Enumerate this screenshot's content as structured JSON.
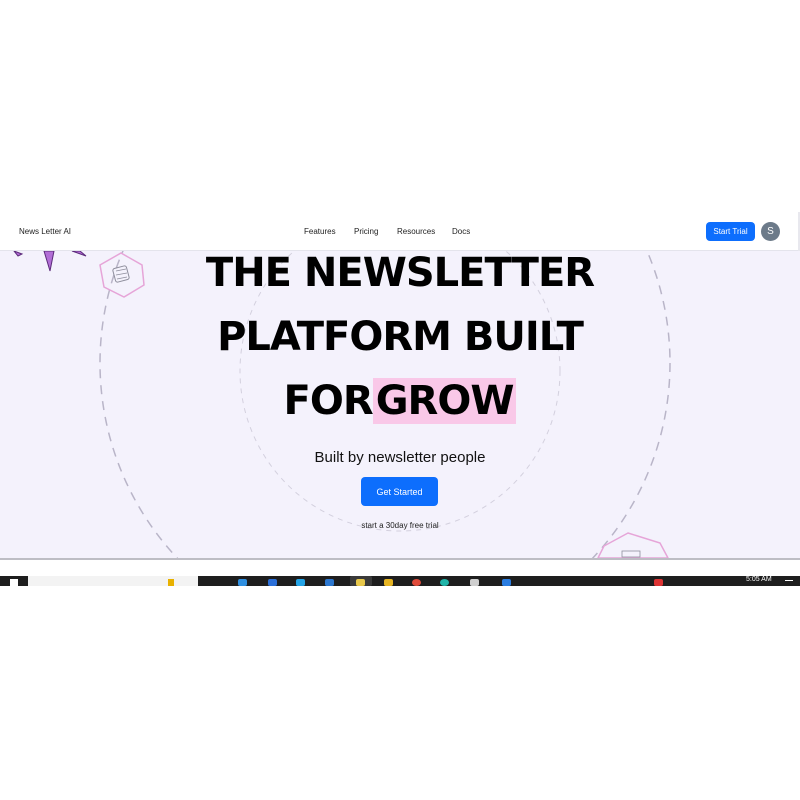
{
  "navbar": {
    "brand": "News Letter AI",
    "links": [
      "Features",
      "Pricing",
      "Resources",
      "Docs"
    ],
    "cta_label": "Start Trial",
    "avatar_initial": "S"
  },
  "hero": {
    "headline_line1": "THE NEWSLETTER",
    "headline_line2": "PLATFORM BUILT",
    "headline_line3_prefix": "FOR",
    "headline_line3_highlight": "GROW",
    "subtitle": "Built by newsletter people",
    "cta_label": "Get Started",
    "note": "start a 30day free trial"
  },
  "taskbar": {
    "time": "5:05 AM"
  },
  "colors": {
    "accent": "#0d6efd",
    "hero_bg": "#f4f2fc",
    "highlight": "#f9c8e8",
    "taskbar": "#1e1e1e"
  }
}
